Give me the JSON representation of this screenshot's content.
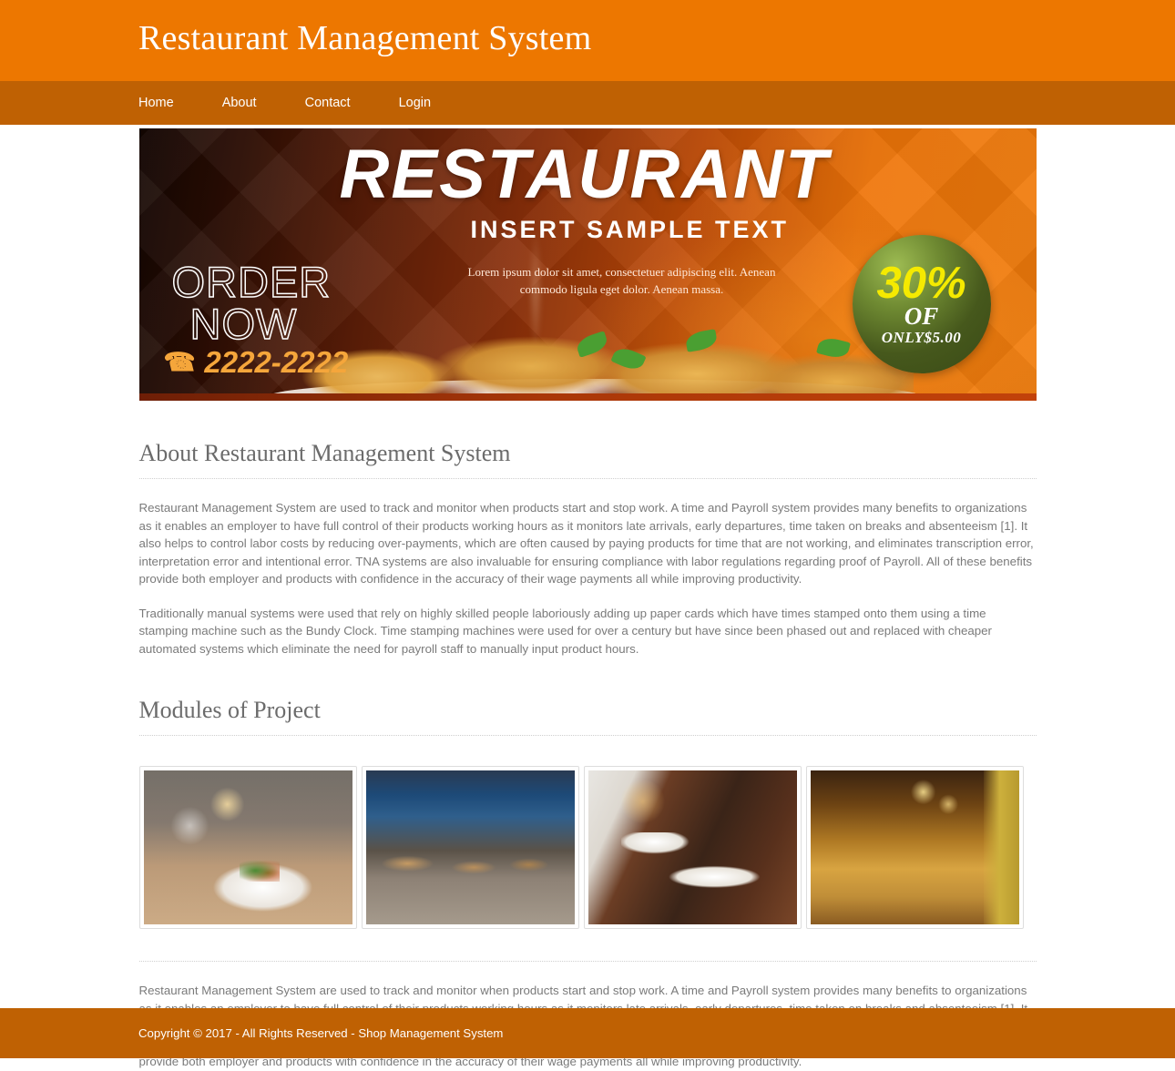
{
  "header": {
    "title": "Restaurant Management System",
    "bg_color": "#ED7700"
  },
  "nav": {
    "bg_color": "#BF6103",
    "items": [
      {
        "label": "Home"
      },
      {
        "label": "About"
      },
      {
        "label": "Contact"
      },
      {
        "label": "Login"
      }
    ]
  },
  "banner": {
    "title": "RESTAURANT",
    "subtitle": "INSERT SAMPLE TEXT",
    "lorem": "Lorem ipsum dolor sit amet, consectetuer adipiscing elit. Aenean commodo ligula eget dolor. Aenean massa.",
    "order_line1": "ORDER",
    "order_line2": "NOW",
    "phone_icon": "phone-icon",
    "phone": "2222-2222",
    "badge": {
      "percent": "30%",
      "of": "OF",
      "price": "ONLY$5.00",
      "circle_color": "#46581c",
      "percent_color": "#f5ea00"
    }
  },
  "about": {
    "heading": "About Restaurant Management System",
    "paragraph1": "Restaurant Management System are used to track and monitor when products start and stop work. A time and Payroll system provides many benefits to organizations as it enables an employer to have full control of their products working hours as it monitors late arrivals, early departures, time taken on breaks and absenteeism [1]. It also helps to control labor costs by reducing over-payments, which are often caused by paying products for time that are not working, and eliminates transcription error, interpretation error and intentional error. TNA systems are also invaluable for ensuring compliance with labor regulations regarding proof of Payroll. All of these benefits provide both employer and products with confidence in the accuracy of their wage payments all while improving productivity.",
    "paragraph2": "Traditionally manual systems were used that rely on highly skilled people laboriously adding up paper cards which have times stamped onto them using a time stamping machine such as the Bundy Clock. Time stamping machines were used for over a century but have since been phased out and replaced with cheaper automated systems which eliminate the need for payroll staff to manually input product hours."
  },
  "modules": {
    "heading": "Modules of Project",
    "thumbnails": [
      {
        "alt": "plated-dish-with-wine-glasses"
      },
      {
        "alt": "blue-dining-room-interior"
      },
      {
        "alt": "waiter-serving-plates"
      },
      {
        "alt": "warm-lit-bistro-interior"
      }
    ]
  },
  "bottom": {
    "paragraph": "Restaurant Management System are used to track and monitor when products start and stop work. A time and Payroll system provides many benefits to organizations as it enables an employer to have full control of their products working hours as it monitors late arrivals, early departures, time taken on breaks and absenteeism [1]. It also helps to control labor costs by reducing over-payments, which are often caused by paying products for time that are not working, and eliminates transcription error, interpretation error and intentional error. TNA systems are also invaluable for ensuring compliance with labor regulations regarding proof of Payroll. All of these benefits provide both employer and products with confidence in the accuracy of their wage payments all while improving productivity."
  },
  "footer": {
    "text": "Copyright © 2017 - All Rights Reserved - Shop Management System",
    "bg_color": "#BF6103"
  }
}
